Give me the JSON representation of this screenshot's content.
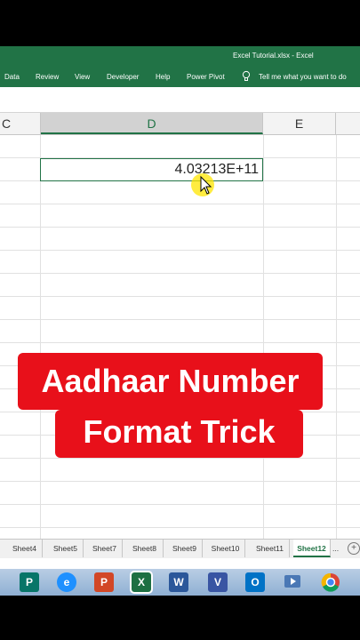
{
  "window": {
    "title": "Excel Tutorial.xlsx - Excel"
  },
  "ribbon": {
    "tabs": [
      "Data",
      "Review",
      "View",
      "Developer",
      "Help",
      "Power Pivot"
    ],
    "tell_me": "Tell me what you want to do"
  },
  "columns": [
    "C",
    "D",
    "E"
  ],
  "cell": {
    "value": "4.03213E+11"
  },
  "overlay": {
    "line1": "Aadhaar Number",
    "line2": "Format Trick"
  },
  "sheets": {
    "tabs": [
      "Sheet4",
      "Sheet5",
      "Sheet7",
      "Sheet8",
      "Sheet9",
      "Sheet10",
      "Sheet11",
      "Sheet12"
    ],
    "active": "Sheet12",
    "more": "...",
    "add": "+"
  },
  "taskbar": {
    "apps": [
      {
        "name": "publisher",
        "letter": "P",
        "color": "#077568"
      },
      {
        "name": "ie",
        "letter": "e",
        "color": "#1e90ff"
      },
      {
        "name": "powerpoint",
        "letter": "P",
        "color": "#d24726"
      },
      {
        "name": "excel",
        "letter": "X",
        "color": "#1d6f42"
      },
      {
        "name": "word",
        "letter": "W",
        "color": "#2b579a"
      },
      {
        "name": "visio",
        "letter": "V",
        "color": "#3955a3"
      },
      {
        "name": "outlook",
        "letter": "O",
        "color": "#0072c6"
      }
    ]
  },
  "colors": {
    "excel_green": "#217346",
    "banner_red": "#e8101a"
  }
}
